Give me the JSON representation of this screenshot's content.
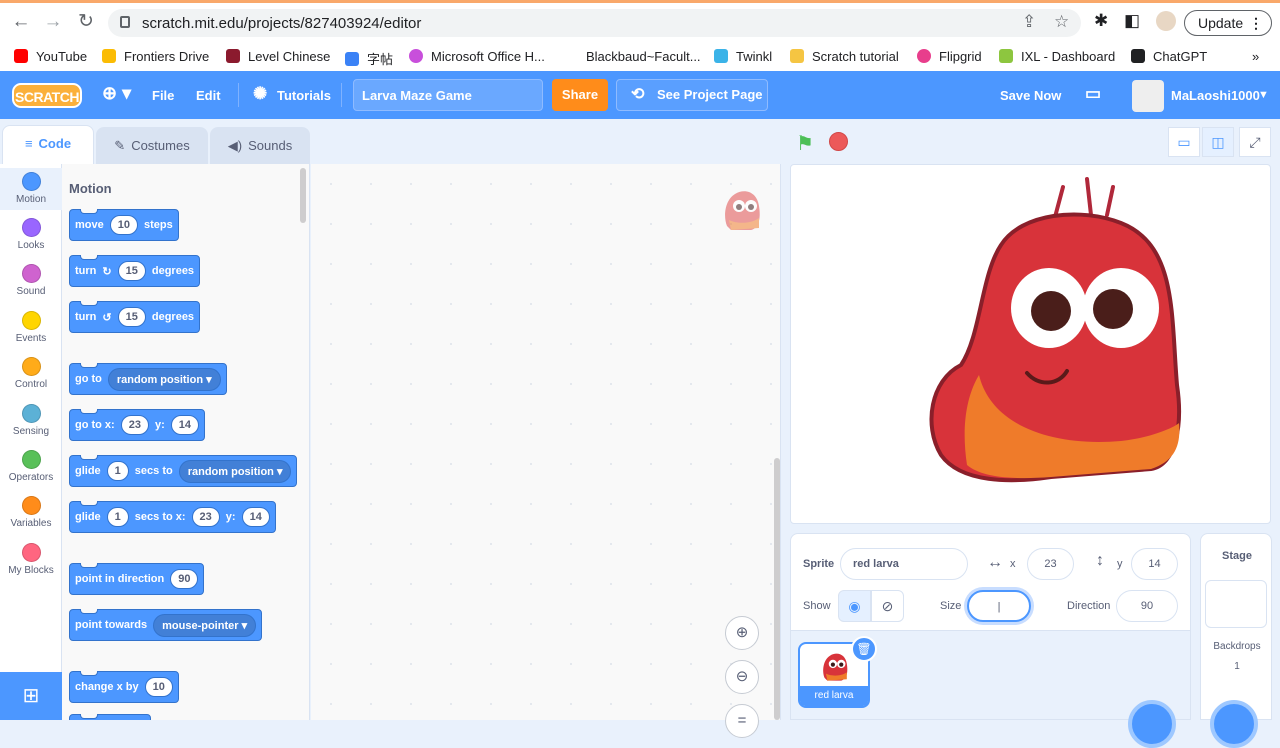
{
  "browser": {
    "url": "scratch.mit.edu/projects/827403924/editor",
    "update_label": "Update",
    "bookmarks": [
      "YouTube",
      "Frontiers Drive",
      "Level Chinese",
      "字帖",
      "Microsoft Office H...",
      "Blackbaud~Facult...",
      "Twinkl",
      "Scratch tutorial",
      "Flipgrid",
      "IXL - Dashboard",
      "ChatGPT"
    ],
    "more": "»"
  },
  "menubar": {
    "logo": "SCRATCH",
    "file": "File",
    "edit": "Edit",
    "tutorials": "Tutorials",
    "project_title": "Larva Maze Game",
    "share": "Share",
    "see_project_page": "See Project Page",
    "save_now": "Save Now",
    "username": "MaLaoshi1000"
  },
  "tabs": {
    "code": "Code",
    "costumes": "Costumes",
    "sounds": "Sounds"
  },
  "categories": [
    "Motion",
    "Looks",
    "Sound",
    "Events",
    "Control",
    "Sensing",
    "Operators",
    "Variables",
    "My Blocks"
  ],
  "category_colors": [
    "#4c97ff",
    "#9966ff",
    "#cf63cf",
    "#ffd500",
    "#ffab19",
    "#5cb1d6",
    "#59c059",
    "#ff8c1a",
    "#ff6680"
  ],
  "palette": {
    "heading": "Motion",
    "move": {
      "a": "move",
      "n": "10",
      "b": "steps"
    },
    "turn_cw": {
      "a": "turn",
      "n": "15",
      "b": "degrees"
    },
    "turn_ccw": {
      "a": "turn",
      "n": "15",
      "b": "degrees"
    },
    "goto": {
      "a": "go to",
      "dd": "random position"
    },
    "gotoxy": {
      "a": "go to x:",
      "x": "23",
      "y_lbl": "y:",
      "y": "14"
    },
    "glide": {
      "a": "glide",
      "n": "1",
      "b": "secs to",
      "dd": "random position"
    },
    "glidexy": {
      "a": "glide",
      "n": "1",
      "b": "secs to x:",
      "x": "23",
      "y_lbl": "y:",
      "y": "14"
    },
    "point_dir": {
      "a": "point in direction",
      "n": "90"
    },
    "point_towards": {
      "a": "point towards",
      "dd": "mouse-pointer"
    },
    "change_x": {
      "a": "change x by",
      "n": "10"
    }
  },
  "sprite_info": {
    "sprite_label": "Sprite",
    "sprite_name": "red larva",
    "x_label": "x",
    "x": "23",
    "y_label": "y",
    "y": "14",
    "show_label": "Show",
    "size_label": "Size",
    "size": "|",
    "direction_label": "Direction",
    "direction": "90"
  },
  "sprite_list": [
    {
      "name": "red larva"
    }
  ],
  "stage_panel": {
    "title": "Stage",
    "backdrops_label": "Backdrops",
    "backdrops_count": "1"
  }
}
